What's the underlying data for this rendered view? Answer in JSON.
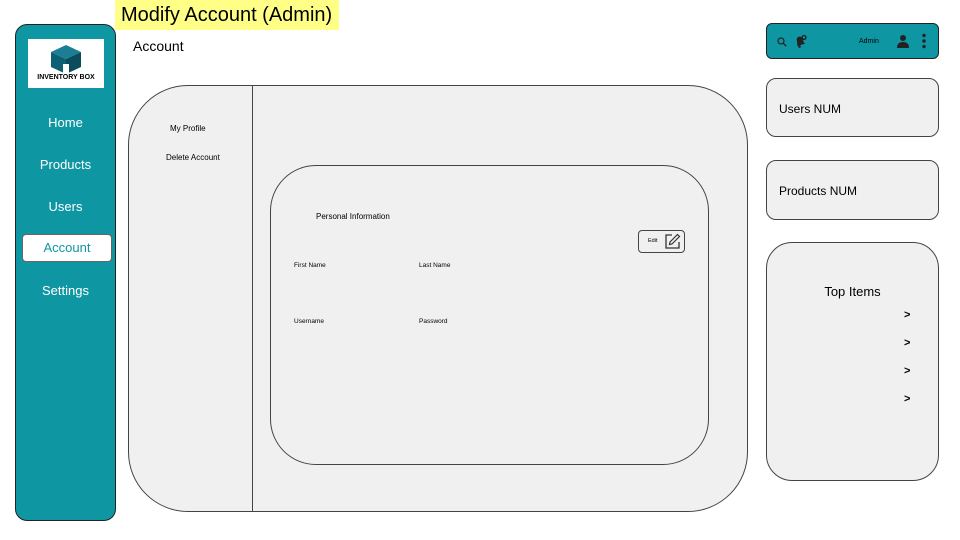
{
  "banner": {
    "title": "Modify Account (Admin)"
  },
  "page": {
    "title": "Account"
  },
  "logo": {
    "text": "INVENTORY BOX"
  },
  "nav": {
    "items": [
      "Home",
      "Products",
      "Users",
      "Account",
      "Settings"
    ],
    "active": "Account"
  },
  "account_menu": {
    "items": [
      "My Profile",
      "Delete Account"
    ]
  },
  "personal_info": {
    "heading": "Personal Information",
    "edit_label": "Edit",
    "fields": {
      "first_name": "First Name",
      "last_name": "Last Name",
      "username": "Username",
      "password": "Password"
    }
  },
  "topbar": {
    "user": "Admin",
    "icons": [
      "search-icon",
      "notification-bell-icon",
      "user-icon",
      "more-vertical-icon"
    ]
  },
  "stats": {
    "users": "Users  NUM",
    "products": "Products  NUM"
  },
  "top_items": {
    "title": "Top Items",
    "chevrons": [
      ">",
      ">",
      ">",
      ">"
    ]
  },
  "colors": {
    "accent": "#0f96a3",
    "banner": "#ffff88",
    "panel": "#f0f0f0"
  }
}
